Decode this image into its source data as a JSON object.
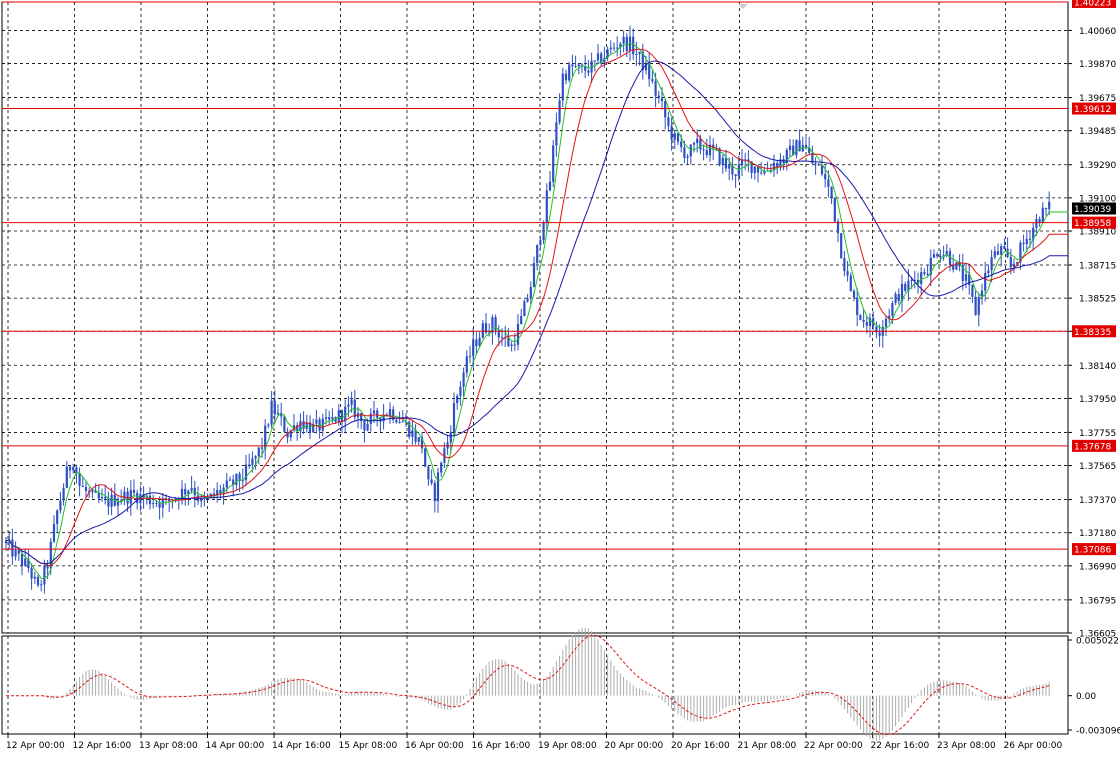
{
  "chart_data": {
    "type": "candlestick",
    "grid": true,
    "colors": {
      "candles": "#2c4fc3",
      "ma_fast": "#22c02a",
      "ma_mid": "#e01515",
      "ma_slow": "#1a1aa8",
      "hline": "#e00000",
      "current_price": "#000000",
      "osc_hist": "#aaaaaa",
      "osc_signal": "#e01515"
    },
    "price_axis": {
      "min": 1.36605,
      "max": 1.40223,
      "ticks": [
        "1.40060",
        "1.39870",
        "1.39675",
        "1.39485",
        "1.39290",
        "1.39100",
        "1.38910",
        "1.38715",
        "1.38525",
        "1.38335",
        "1.38140",
        "1.37950",
        "1.37755",
        "1.37565",
        "1.37370",
        "1.37180",
        "1.36990",
        "1.36795",
        "1.36605"
      ]
    },
    "horizontal_levels": [
      "1.40223",
      "1.39612",
      "1.38958",
      "1.38335",
      "1.37678",
      "1.37086"
    ],
    "current_price": "1.39039",
    "x_axis_labels": [
      "12 Apr 00:00",
      "12 Apr 16:00",
      "13 Apr 08:00",
      "14 Apr 00:00",
      "14 Apr 16:00",
      "15 Apr 08:00",
      "16 Apr 00:00",
      "16 Apr 16:00",
      "19 Apr 08:00",
      "20 Apr 00:00",
      "20 Apr 16:00",
      "21 Apr 08:00",
      "22 Apr 00:00",
      "22 Apr 16:00",
      "23 Apr 08:00",
      "26 Apr 00:00"
    ],
    "price_path": [
      [
        0,
        1.3712
      ],
      [
        3,
        1.3705
      ],
      [
        7,
        1.3698
      ],
      [
        10,
        1.3685
      ],
      [
        13,
        1.37
      ],
      [
        16,
        1.373
      ],
      [
        19,
        1.3752
      ],
      [
        21,
        1.376
      ],
      [
        23,
        1.3745
      ],
      [
        27,
        1.3738
      ],
      [
        31,
        1.3735
      ],
      [
        35,
        1.3738
      ],
      [
        40,
        1.374
      ],
      [
        45,
        1.3737
      ],
      [
        50,
        1.3735
      ],
      [
        54,
        1.374
      ],
      [
        58,
        1.3745
      ],
      [
        61,
        1.3735
      ],
      [
        64,
        1.3738
      ],
      [
        67,
        1.3742
      ],
      [
        70,
        1.3745
      ],
      [
        74,
        1.375
      ],
      [
        77,
        1.3758
      ],
      [
        80,
        1.3768
      ],
      [
        83,
        1.379
      ],
      [
        85,
        1.3785
      ],
      [
        88,
        1.3775
      ],
      [
        92,
        1.3782
      ],
      [
        96,
        1.3778
      ],
      [
        100,
        1.378
      ],
      [
        104,
        1.3785
      ],
      [
        108,
        1.379
      ],
      [
        112,
        1.378
      ],
      [
        116,
        1.3785
      ],
      [
        120,
        1.3788
      ],
      [
        124,
        1.3782
      ],
      [
        127,
        1.3775
      ],
      [
        130,
        1.3768
      ],
      [
        132,
        1.3745
      ],
      [
        134,
        1.374
      ],
      [
        136,
        1.376
      ],
      [
        138,
        1.377
      ],
      [
        140,
        1.379
      ],
      [
        143,
        1.381
      ],
      [
        146,
        1.3825
      ],
      [
        149,
        1.3835
      ],
      [
        152,
        1.3838
      ],
      [
        155,
        1.383
      ],
      [
        158,
        1.3825
      ],
      [
        161,
        1.384
      ],
      [
        164,
        1.386
      ],
      [
        167,
        1.389
      ],
      [
        170,
        1.392
      ],
      [
        172,
        1.3955
      ],
      [
        174,
        1.398
      ],
      [
        177,
        1.3985
      ],
      [
        180,
        1.3983
      ],
      [
        183,
        1.3985
      ],
      [
        186,
        1.399
      ],
      [
        189,
        1.3995
      ],
      [
        192,
        1.4
      ],
      [
        195,
        1.3998
      ],
      [
        198,
        1.399
      ],
      [
        201,
        1.398
      ],
      [
        203,
        1.397
      ],
      [
        205,
        1.3962
      ],
      [
        207,
        1.395
      ],
      [
        210,
        1.394
      ],
      [
        213,
        1.3935
      ],
      [
        216,
        1.394
      ],
      [
        219,
        1.3938
      ],
      [
        222,
        1.3935
      ],
      [
        225,
        1.3928
      ],
      [
        228,
        1.3925
      ],
      [
        231,
        1.393
      ],
      [
        234,
        1.3928
      ],
      [
        237,
        1.3925
      ],
      [
        240,
        1.393
      ],
      [
        243,
        1.3932
      ],
      [
        246,
        1.3938
      ],
      [
        249,
        1.3942
      ],
      [
        252,
        1.393
      ],
      [
        255,
        1.3925
      ],
      [
        258,
        1.391
      ],
      [
        261,
        1.388
      ],
      [
        264,
        1.3855
      ],
      [
        267,
        1.3842
      ],
      [
        270,
        1.3838
      ],
      [
        273,
        1.3835
      ],
      [
        276,
        1.3845
      ],
      [
        279,
        1.3855
      ],
      [
        282,
        1.386
      ],
      [
        285,
        1.3865
      ],
      [
        288,
        1.387
      ],
      [
        291,
        1.388
      ],
      [
        294,
        1.3878
      ],
      [
        297,
        1.387
      ],
      [
        300,
        1.3862
      ],
      [
        303,
        1.3845
      ],
      [
        305,
        1.386
      ],
      [
        308,
        1.3875
      ],
      [
        311,
        1.388
      ],
      [
        314,
        1.387
      ],
      [
        317,
        1.388
      ],
      [
        320,
        1.389
      ],
      [
        323,
        1.39
      ],
      [
        326,
        1.3904
      ]
    ],
    "oscillator": {
      "ticks": [
        "0.005022",
        "0.00",
        "-0.003096"
      ],
      "max": 0.005022,
      "min": -0.003096
    }
  }
}
